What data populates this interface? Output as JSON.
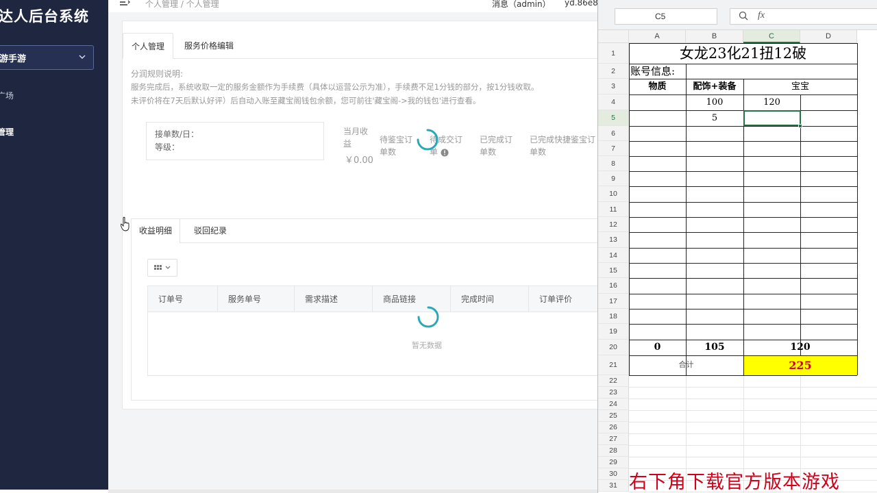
{
  "sidebar": {
    "brand": "达人后台系统",
    "game_select": "游手游",
    "nav": [
      "广场",
      "管理"
    ]
  },
  "topbar": {
    "breadcrumb": "个人管理 / 个人管理",
    "message": "消息（admin）",
    "user": "yd.86e8"
  },
  "tabs": [
    "个人管理",
    "服务价格编辑"
  ],
  "rules": {
    "title": "分润规则说明:",
    "line1": "服务完成后，系统收取一定的服务金额作为手续费（具体以运营公示为准），手续费不足1分钱的部分，按1分钱收取。",
    "line2": "未评价将在7天后默认好评）后自动入账至藏宝阁钱包余额，您可前往'藏宝阁->我的钱包'进行查看。"
  },
  "stats": {
    "orders_per_day": "接单数/日：",
    "level": "等级：",
    "monthly_income": "当月收益",
    "monthly_amount": "￥0.00",
    "pending_appraise": "待鉴宝订单数",
    "pending_delivery": "待成交订单",
    "completed": "已完成订单数",
    "completed_quick": "已完成快捷鉴宝订单数"
  },
  "income_tabs": [
    "收益明细",
    "驳回纪录"
  ],
  "table": {
    "columns": [
      "订单号",
      "服务单号",
      "需求描述",
      "商品链接",
      "完成时间",
      "订单评价"
    ],
    "empty": "暂无数据"
  },
  "spreadsheet": {
    "name_box": "C5",
    "fx": "fx",
    "columns": [
      "A",
      "B",
      "C",
      "D"
    ],
    "rows": [
      "1",
      "2",
      "3",
      "4",
      "5",
      "6",
      "7",
      "8",
      "9",
      "10",
      "11",
      "12",
      "13",
      "14",
      "15",
      "16",
      "17",
      "18",
      "19",
      "20",
      "21",
      "22",
      "23",
      "24",
      "25",
      "26",
      "27",
      "28",
      "29",
      "30",
      "31"
    ],
    "title": "女龙23化21扭12破",
    "account": "账号信息:",
    "headers": [
      "物质",
      "配饰+装备",
      "宝宝"
    ],
    "r4_b": "100",
    "r4_c": "120",
    "r5_b": "5",
    "totals": [
      "0",
      "105",
      "120"
    ],
    "sum_label": "合计",
    "sum_value": "225",
    "sum_value_color": "#d0021b",
    "highlight_color": "#ffff00"
  },
  "watermark": "右下角下载官方版本游戏"
}
